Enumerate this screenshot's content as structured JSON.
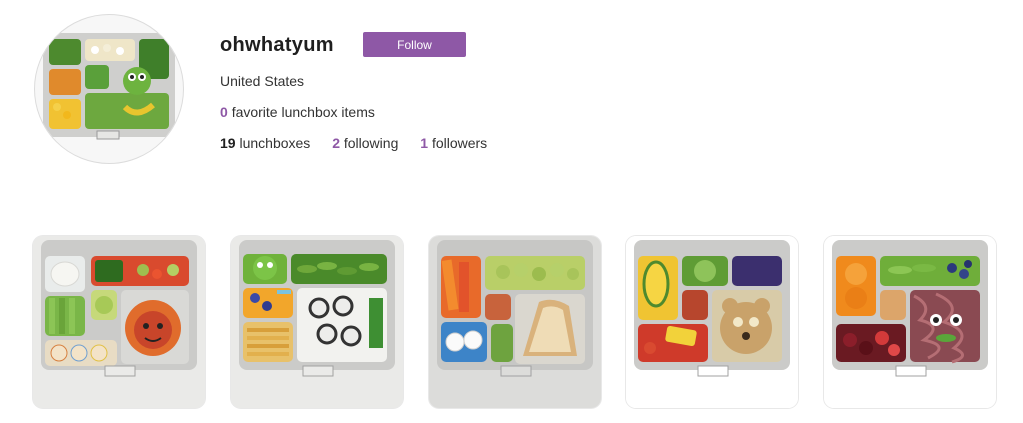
{
  "profile": {
    "username": "ohwhatyum",
    "follow_label": "Follow",
    "country": "United States",
    "favorites_count": "0",
    "favorites_label": "favorite lunchbox items",
    "lunchboxes_count": "19",
    "lunchboxes_label": "lunchboxes",
    "following_count": "2",
    "following_label": "following",
    "followers_count": "1",
    "followers_label": "followers"
  },
  "colors": {
    "accent": "#8e58a6",
    "tray": "#c9c9c7"
  },
  "lunchboxes": [
    {
      "name": "lunchbox-lion",
      "background": "#e9e9e7",
      "foods": [
        "dip",
        "cucumber sticks",
        "snap peas",
        "red pepper",
        "grapes",
        "pinwheel tortilla",
        "lion face pizza"
      ]
    },
    {
      "name": "lunchbox-frog",
      "background": "#e9e9e7",
      "foods": [
        "frog dip",
        "edamame",
        "berries",
        "sushi rolls",
        "pretzel sticks"
      ]
    },
    {
      "name": "lunchbox-sandwich",
      "background": "#e9e9e7",
      "foods": [
        "carrots",
        "grapes",
        "sandwich",
        "pretzels",
        "cucumber"
      ]
    },
    {
      "name": "lunchbox-bear",
      "background": "#ffffff",
      "foods": [
        "peppers",
        "cucumber",
        "berries",
        "bear toast",
        "tomatoes"
      ]
    },
    {
      "name": "lunchbox-noodle-monster",
      "background": "#ffffff",
      "foods": [
        "orange slices",
        "snap peas",
        "blueberries",
        "noodle monster",
        "cherries"
      ]
    }
  ]
}
